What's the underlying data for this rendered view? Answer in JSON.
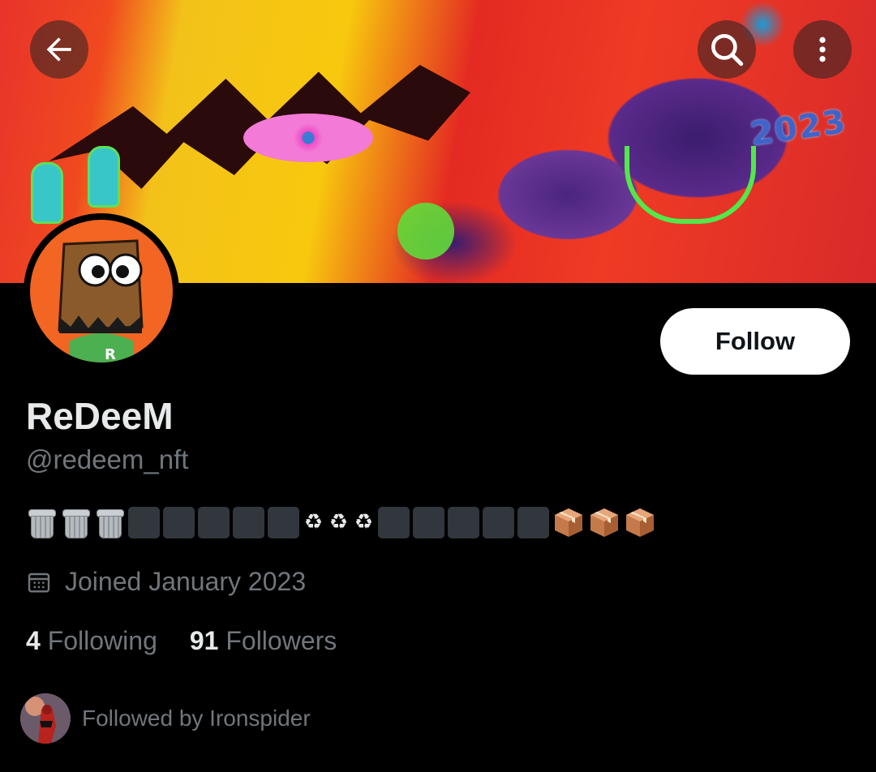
{
  "header": {
    "back_icon": "arrow-left-icon",
    "search_icon": "search-icon",
    "more_icon": "more-vertical-icon",
    "banner_year_text": "2023"
  },
  "profile": {
    "display_name": "ReDeeM",
    "handle": "@redeem_nft",
    "follow_label": "Follow",
    "bio_emojis": [
      "wastebasket",
      "wastebasket",
      "wastebasket",
      "black-square",
      "black-square",
      "black-square",
      "black-square",
      "black-square",
      "recycle",
      "recycle",
      "recycle",
      "black-square",
      "black-square",
      "black-square",
      "black-square",
      "black-square",
      "package",
      "package",
      "package"
    ],
    "recycle_glyph": "♻",
    "joined": "Joined January 2023",
    "joined_icon": "calendar-icon"
  },
  "stats": {
    "following_count": "4",
    "following_label": "Following",
    "followers_count": "91",
    "followers_label": "Followers"
  },
  "followed_by": {
    "text": "Followed by Ironspider"
  },
  "colors": {
    "background": "#000000",
    "text_primary": "#e7e9ea",
    "text_secondary": "#71767b",
    "follow_button_bg": "#ffffff",
    "avatar_bg": "#f26522"
  }
}
